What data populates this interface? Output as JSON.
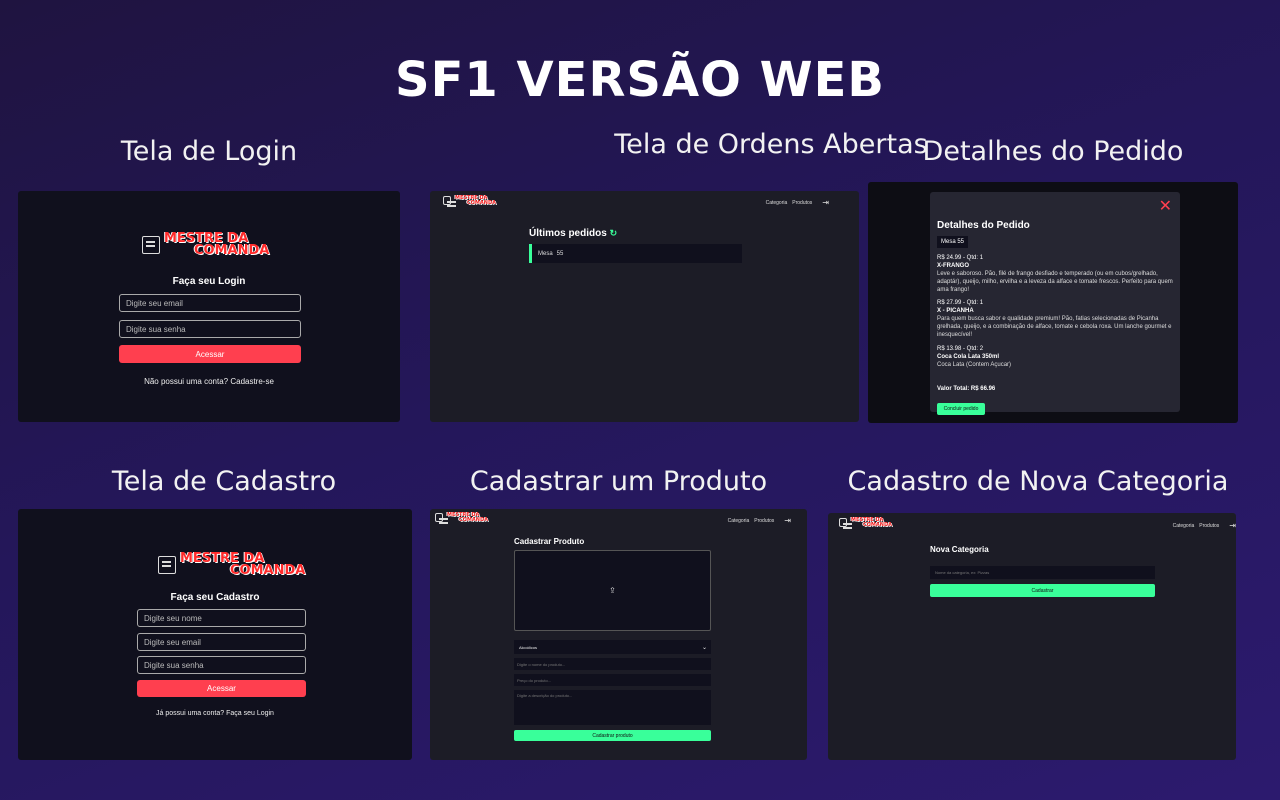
{
  "main_title": "SF1  VERSÃO WEB",
  "sections": {
    "login": "Tela de Login",
    "orders": "Tela de Ordens Abertas",
    "details": "Detalhes  do Pedido",
    "register": "Tela de Cadastro",
    "product": "Cadastrar um Produto",
    "category": "Cadastro de Nova Categoria"
  },
  "logo": {
    "line1": "MESTRE DA",
    "line2": "COMANDA"
  },
  "nav": {
    "categoria": "Categoria",
    "produtos": "Produtos"
  },
  "login": {
    "heading": "Faça seu Login",
    "email_placeholder": "Digite seu email",
    "password_placeholder": "Digite sua senha",
    "submit": "Acessar",
    "footer": "Não possui uma conta? Cadastre-se"
  },
  "orders": {
    "heading": "Últimos pedidos",
    "row_label": "Mesa",
    "row_value": "55"
  },
  "details": {
    "title": "Detalhes do Pedido",
    "mesa": "Mesa 55",
    "items": [
      {
        "price": "R$ 24.99 - Qtd: 1",
        "name": "X-FRANGO",
        "desc": "Leve e saboroso. Pão, filé de frango desfiado e temperado (ou em cubos/grelhado, adaptár), queijo, milho, ervilha e a leveza da alface e tomate frescos. Perfeito para quem ama frango!"
      },
      {
        "price": "R$ 27.99 - Qtd: 1",
        "name": "X - PICANHA",
        "desc": "Para quem busca sabor e qualidade premium! Pão, fatias selecionadas de Picanha grelhada, queijo, e a combinação de alface, tomate e cebola roxa. Um lanche gourmet e inesquecível!"
      },
      {
        "price": "R$ 13.98 - Qtd: 2",
        "name": "Coca Cola Lata 350ml",
        "desc": "Coca Lata (Contem Açucar)"
      }
    ],
    "total": "Valor Total: R$ 66.96",
    "conclude": "Concluir pedido"
  },
  "register": {
    "heading": "Faça seu Cadastro",
    "name_placeholder": "Digite seu nome",
    "email_placeholder": "Digite seu email",
    "password_placeholder": "Digite sua senha",
    "submit": "Acessar",
    "footer": "Já possui uma conta? Faça seu Login"
  },
  "product": {
    "heading": "Cadastrar Produto",
    "category_select": "Alcoólicos",
    "name_placeholder": "Digite o nome do produto...",
    "price_placeholder": "Preço do produto...",
    "desc_placeholder": "Digite a descrição do produto...",
    "submit": "Cadastrar produto"
  },
  "category": {
    "heading": "Nova Categoria",
    "name_placeholder": "Nome da categoria, ex: Pizzas",
    "submit": "Cadastrar"
  },
  "colors": {
    "accent_red": "#ff3f4f",
    "accent_green": "#39ff9a",
    "panel": "#1c1c26",
    "panel_dark": "#10101d"
  }
}
